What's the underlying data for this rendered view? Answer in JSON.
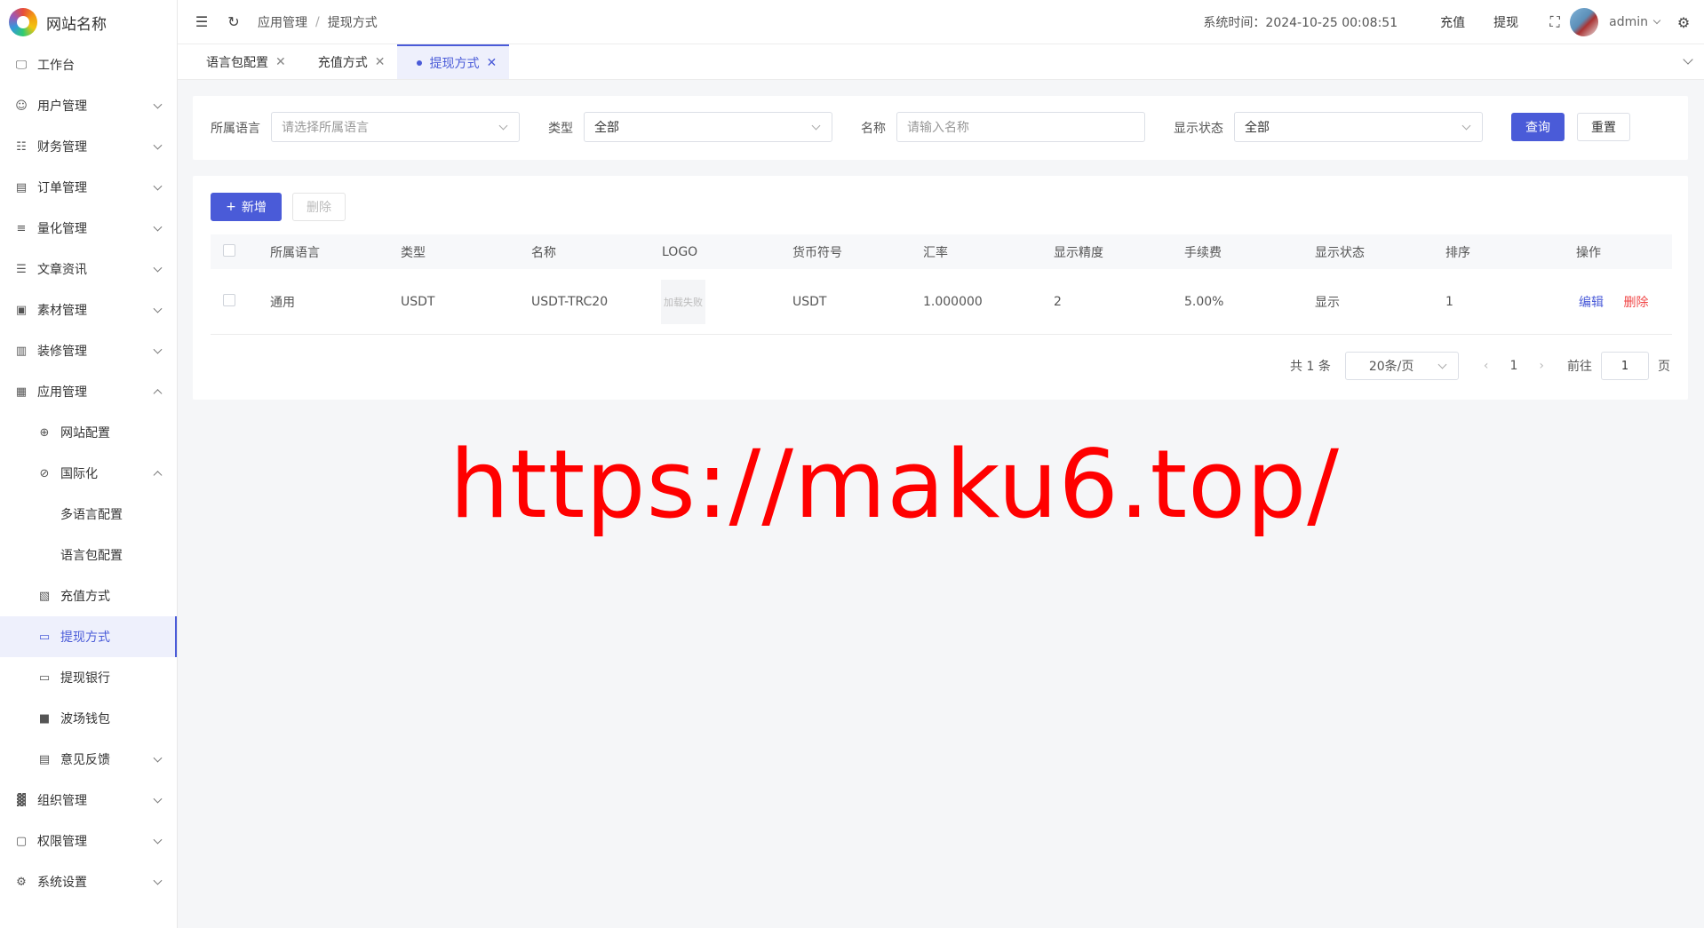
{
  "brand": {
    "name": "网站名称"
  },
  "sidebar": {
    "items": [
      {
        "label": "工作台",
        "icon": "monitor-icon"
      },
      {
        "label": "用户管理",
        "icon": "user-icon"
      },
      {
        "label": "财务管理",
        "icon": "chart-icon"
      },
      {
        "label": "订单管理",
        "icon": "order-icon"
      },
      {
        "label": "量化管理",
        "icon": "quant-icon"
      },
      {
        "label": "文章资讯",
        "icon": "article-icon"
      },
      {
        "label": "素材管理",
        "icon": "image-icon"
      },
      {
        "label": "装修管理",
        "icon": "decor-icon"
      },
      {
        "label": "应用管理",
        "icon": "app-icon"
      },
      {
        "label": "网站配置",
        "icon": "globe-icon"
      },
      {
        "label": "国际化",
        "icon": "i18n-icon"
      },
      {
        "label": "多语言配置"
      },
      {
        "label": "语言包配置"
      },
      {
        "label": "充值方式",
        "icon": "wallet-icon"
      },
      {
        "label": "提现方式",
        "icon": "folder-icon"
      },
      {
        "label": "提现银行",
        "icon": "card-icon"
      },
      {
        "label": "波场钱包",
        "icon": "tron-wallet-icon"
      },
      {
        "label": "意见反馈",
        "icon": "feedback-icon"
      },
      {
        "label": "组织管理",
        "icon": "org-icon"
      },
      {
        "label": "权限管理",
        "icon": "lock-icon"
      },
      {
        "label": "系统设置",
        "icon": "gear-icon"
      }
    ]
  },
  "header": {
    "breadcrumb": [
      "应用管理",
      "提现方式"
    ],
    "system_time": "系统时间：2024-10-25 00:08:51",
    "recharge": "充值",
    "withdraw": "提现",
    "user": "admin"
  },
  "tabs": [
    {
      "label": "语言包配置"
    },
    {
      "label": "充值方式"
    },
    {
      "label": "提现方式",
      "active": true
    }
  ],
  "filters": {
    "language_label": "所属语言",
    "language_placeholder": "请选择所属语言",
    "type_label": "类型",
    "type_value": "全部",
    "name_label": "名称",
    "name_placeholder": "请输入名称",
    "status_label": "显示状态",
    "status_value": "全部",
    "query_button": "查询",
    "reset_button": "重置"
  },
  "toolbar": {
    "add_button": "新增",
    "delete_button": "删除"
  },
  "table": {
    "columns": [
      "所属语言",
      "类型",
      "名称",
      "LOGO",
      "货币符号",
      "汇率",
      "显示精度",
      "手续费",
      "显示状态",
      "排序",
      "操作"
    ],
    "rows": [
      {
        "language": "通用",
        "type": "USDT",
        "name": "USDT-TRC20",
        "logo": "加载失败",
        "currency": "USDT",
        "rate": "1.000000",
        "precision": "2",
        "fee": "5.00%",
        "status": "显示",
        "sort": "1",
        "edit": "编辑",
        "delete": "删除"
      }
    ]
  },
  "pagination": {
    "total": "共 1 条",
    "page_size": "20条/页",
    "current_page": "1",
    "goto_label": "前往",
    "goto_value": "1",
    "page_suffix": "页"
  },
  "watermark": "https://maku6.top/",
  "colors": {
    "primary": "#4a5bd8",
    "danger": "#f04848",
    "watermark": "#ff0000"
  }
}
